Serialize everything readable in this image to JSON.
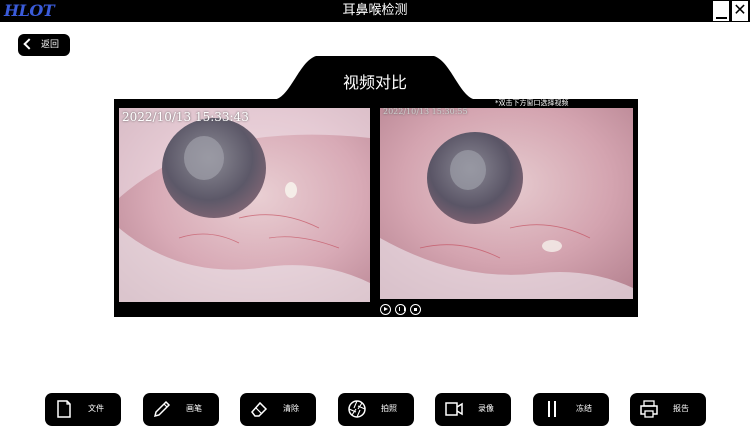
{
  "window": {
    "logo": "HLOT",
    "title": "耳鼻喉检测",
    "minimize_label": "—",
    "close_label": "✕"
  },
  "nav": {
    "back_label": "返回"
  },
  "compare": {
    "title": "视频对比",
    "hint": "*双击下方窗口选择视频",
    "left_timestamp": "2022/10/13 15:33:43",
    "right_timestamp": "2022/10/13 15:30:55"
  },
  "player": {
    "controls": [
      "play-icon",
      "pause-icon",
      "stop-icon"
    ]
  },
  "toolbar": {
    "buttons": [
      {
        "label": "文件",
        "icon": "file-icon"
      },
      {
        "label": "画笔",
        "icon": "pen-icon"
      },
      {
        "label": "清除",
        "icon": "eraser-icon"
      },
      {
        "label": "拍照",
        "icon": "camera-aperture-icon"
      },
      {
        "label": "录像",
        "icon": "video-camera-icon"
      },
      {
        "label": "冻结",
        "icon": "freeze-pause-icon"
      },
      {
        "label": "报告",
        "icon": "printer-icon"
      }
    ]
  },
  "colors": {
    "bar": "#000000",
    "background": "#ffffff",
    "logo": "#3a5bd9"
  }
}
